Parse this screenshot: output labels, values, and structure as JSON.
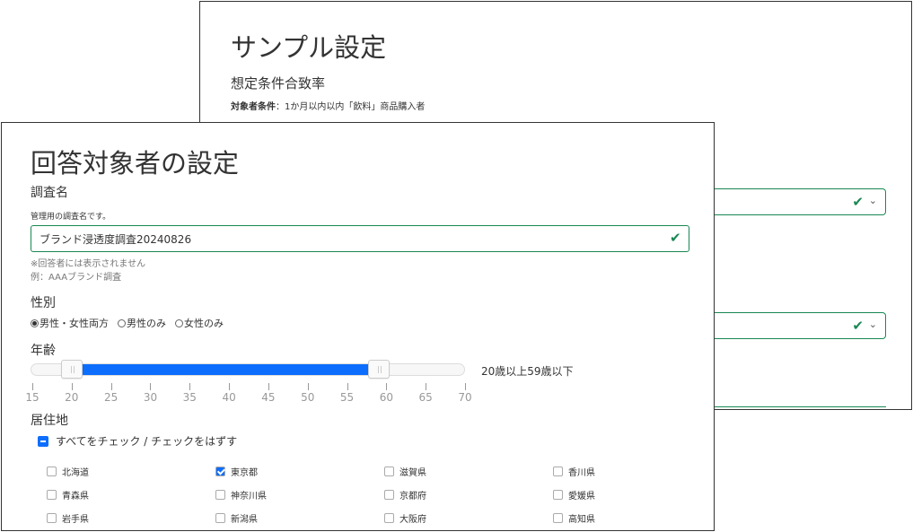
{
  "back_panel": {
    "title": "サンプル設定",
    "subtitle": "想定条件合致率",
    "condition_label": "対象者条件",
    "condition_text": "：1か月以内以内「飲料」商品購入者",
    "check_icon": "✔",
    "chevron_icon": "⌄"
  },
  "front_panel": {
    "title": "回答対象者の設定",
    "survey_name": {
      "label": "調査名",
      "help": "管理用の調査名です。",
      "value": "ブランド浸透度調査20240826",
      "note_hidden": "※回答者には表示されません",
      "note_example": "例：AAAブランド調査"
    },
    "gender": {
      "label": "性別",
      "options": [
        {
          "label": "男性・女性両方",
          "selected": true
        },
        {
          "label": "男性のみ",
          "selected": false
        },
        {
          "label": "女性のみ",
          "selected": false
        }
      ]
    },
    "age": {
      "label": "年齢",
      "min": 15,
      "max": 70,
      "from": 20,
      "to": 59,
      "range_text": "20歳以上59歳以下",
      "ticks": [
        "15",
        "20",
        "25",
        "30",
        "35",
        "40",
        "45",
        "50",
        "55",
        "60",
        "65",
        "70"
      ]
    },
    "residence": {
      "label": "居住地",
      "check_all_label": "すべてをチェック / チェックをはずす",
      "prefectures": [
        [
          "北海道",
          "東京都",
          "滋賀県",
          "香川県"
        ],
        [
          "青森県",
          "神奈川県",
          "京都府",
          "愛媛県"
        ],
        [
          "岩手県",
          "新潟県",
          "大阪府",
          "高知県"
        ]
      ],
      "checked": [
        "東京都"
      ]
    }
  },
  "colors": {
    "valid_green": "#198754",
    "primary_blue": "#0d6efd"
  }
}
